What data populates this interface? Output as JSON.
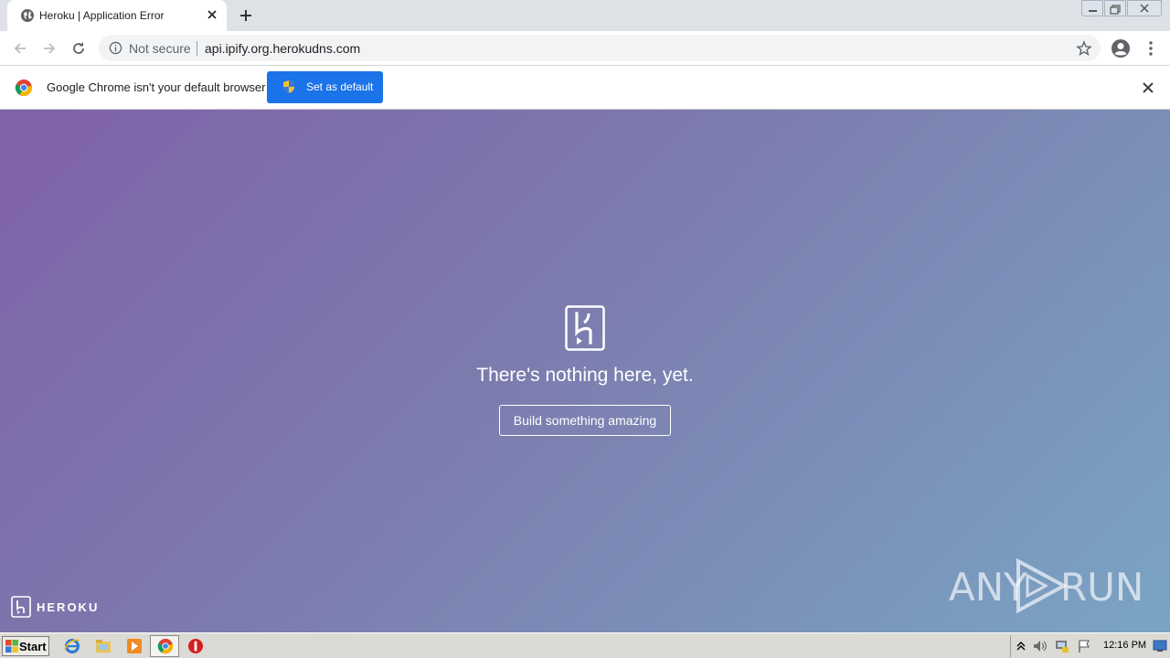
{
  "browser": {
    "tab_title": "Heroku | Application Error",
    "not_secure_label": "Not secure",
    "url": "api.ipify.org.herokudns.com"
  },
  "infobar": {
    "message": "Google Chrome isn't your default browser",
    "button_label": "Set as default"
  },
  "page": {
    "headline": "There's nothing here, yet.",
    "cta_label": "Build something amazing",
    "footer_brand": "HEROKU"
  },
  "watermark": {
    "left": "ANY",
    "right": "RUN"
  },
  "taskbar": {
    "start_label": "Start",
    "clock": "12:16 PM",
    "icons": [
      "ie-icon",
      "explorer-icon",
      "media-player-icon",
      "chrome-icon",
      "antivirus-icon"
    ]
  },
  "colors": {
    "accent": "#1a73e8",
    "gradient_start": "#8062a8",
    "gradient_end": "#7aa4c4"
  }
}
